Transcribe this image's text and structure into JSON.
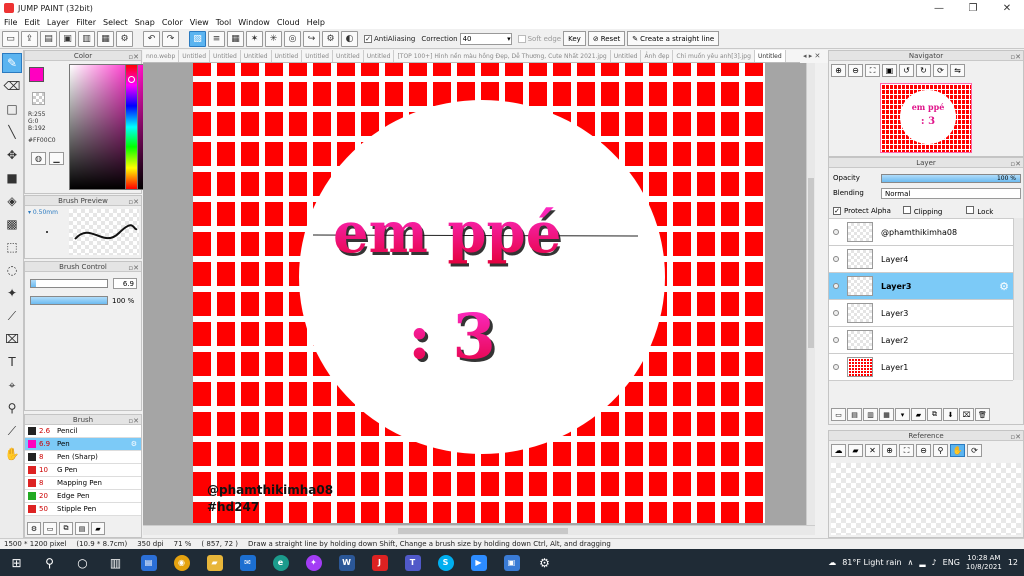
{
  "window": {
    "title": "JUMP PAINT (32bit)",
    "minimize": "—",
    "restore": "❐",
    "close": "✕"
  },
  "menu": [
    "File",
    "Edit",
    "Layer",
    "Filter",
    "Select",
    "Snap",
    "Color",
    "View",
    "Tool",
    "Window",
    "Cloud",
    "Help"
  ],
  "toolbar": {
    "antialiasing_label": "AntiAliasing",
    "correction_label": "Correction",
    "correction_value": "40",
    "soft_edge_label": "Soft edge",
    "key_label": "Key",
    "reset_label": "Reset",
    "straight_line_label": "Create a straight line"
  },
  "color_panel": {
    "title": "Color",
    "r": "R:255",
    "g": "G:0",
    "b": "B:192",
    "hex": "#FF00C0",
    "main_color": "#ff00c0"
  },
  "brush_preview": {
    "title": "Brush Preview",
    "size": "0.50mm"
  },
  "brush_control": {
    "title": "Brush Control",
    "size_value": "6.9",
    "size_fraction": 0.07,
    "opacity_value": "100 %",
    "opacity_fraction": 1.0
  },
  "brush_panel": {
    "title": "Brush",
    "items": [
      {
        "size": "2.6",
        "name": "Pencil",
        "color": "#222222"
      },
      {
        "size": "6.9",
        "name": "Pen",
        "color": "#ff00c0",
        "selected": true
      },
      {
        "size": "8",
        "name": "Pen (Sharp)",
        "color": "#222222"
      },
      {
        "size": "10",
        "name": "G Pen",
        "color": "#dd2222"
      },
      {
        "size": "8",
        "name": "Mapping Pen",
        "color": "#dd2222"
      },
      {
        "size": "20",
        "name": "Edge Pen",
        "color": "#22aa22"
      },
      {
        "size": "50",
        "name": "Stipple Pen",
        "color": "#dd2222"
      }
    ]
  },
  "tabs": {
    "items": [
      "nno.webp",
      "Untitled",
      "Untitled",
      "Untitled",
      "Untitled",
      "Untitled",
      "Untitled",
      "Untitled",
      "[TOP 100+] Hình nền màu hồng Đẹp, Dễ Thương, Cute Nhất 2021.jpg",
      "Untitled",
      "Ảnh đẹp",
      "Chỉ muốn yêu anh[3].jpg",
      "Untitled"
    ],
    "nav": "◂ ▸ ✕"
  },
  "canvas": {
    "title_text": "em ppé",
    "subtitle_text": ": 3",
    "signature_line1": "@phamthikimha08",
    "signature_line2": "#hd247"
  },
  "navigator": {
    "title": "Navigator",
    "thumb_line1": "em ppé",
    "thumb_line2": ": 3"
  },
  "layer_panel": {
    "title": "Layer",
    "opacity_label": "Opacity",
    "opacity_value": "100 %",
    "opacity_fraction": 1.0,
    "blending_label": "Blending",
    "blending_value": "Normal",
    "protect_alpha_label": "Protect Alpha",
    "clipping_label": "Clipping",
    "lock_label": "Lock",
    "layers": [
      {
        "name": "@phamthikimha08",
        "thumb": "text"
      },
      {
        "name": "Layer4",
        "thumb": "transparent"
      },
      {
        "name": "Layer3",
        "thumb": "transparent",
        "selected": true
      },
      {
        "name": "Layer3",
        "thumb": "transparent"
      },
      {
        "name": "Layer2",
        "thumb": "transparent"
      },
      {
        "name": "Layer1",
        "thumb": "red"
      }
    ]
  },
  "reference": {
    "title": "Reference"
  },
  "status": {
    "dimensions": "1500 * 1200 pixel",
    "physical": "(10.9 * 8.7cm)",
    "dpi": "350 dpi",
    "zoom": "71 %",
    "coords": "( 857, 72 )",
    "hint": "Draw a straight line by holding down Shift, Change a brush size by holding down Ctrl, Alt, and dragging"
  },
  "taskbar": {
    "weather": "81°F Light rain",
    "lang": "ENG",
    "time": "10:28 AM",
    "date": "10/8/2021",
    "notifications": "12"
  }
}
